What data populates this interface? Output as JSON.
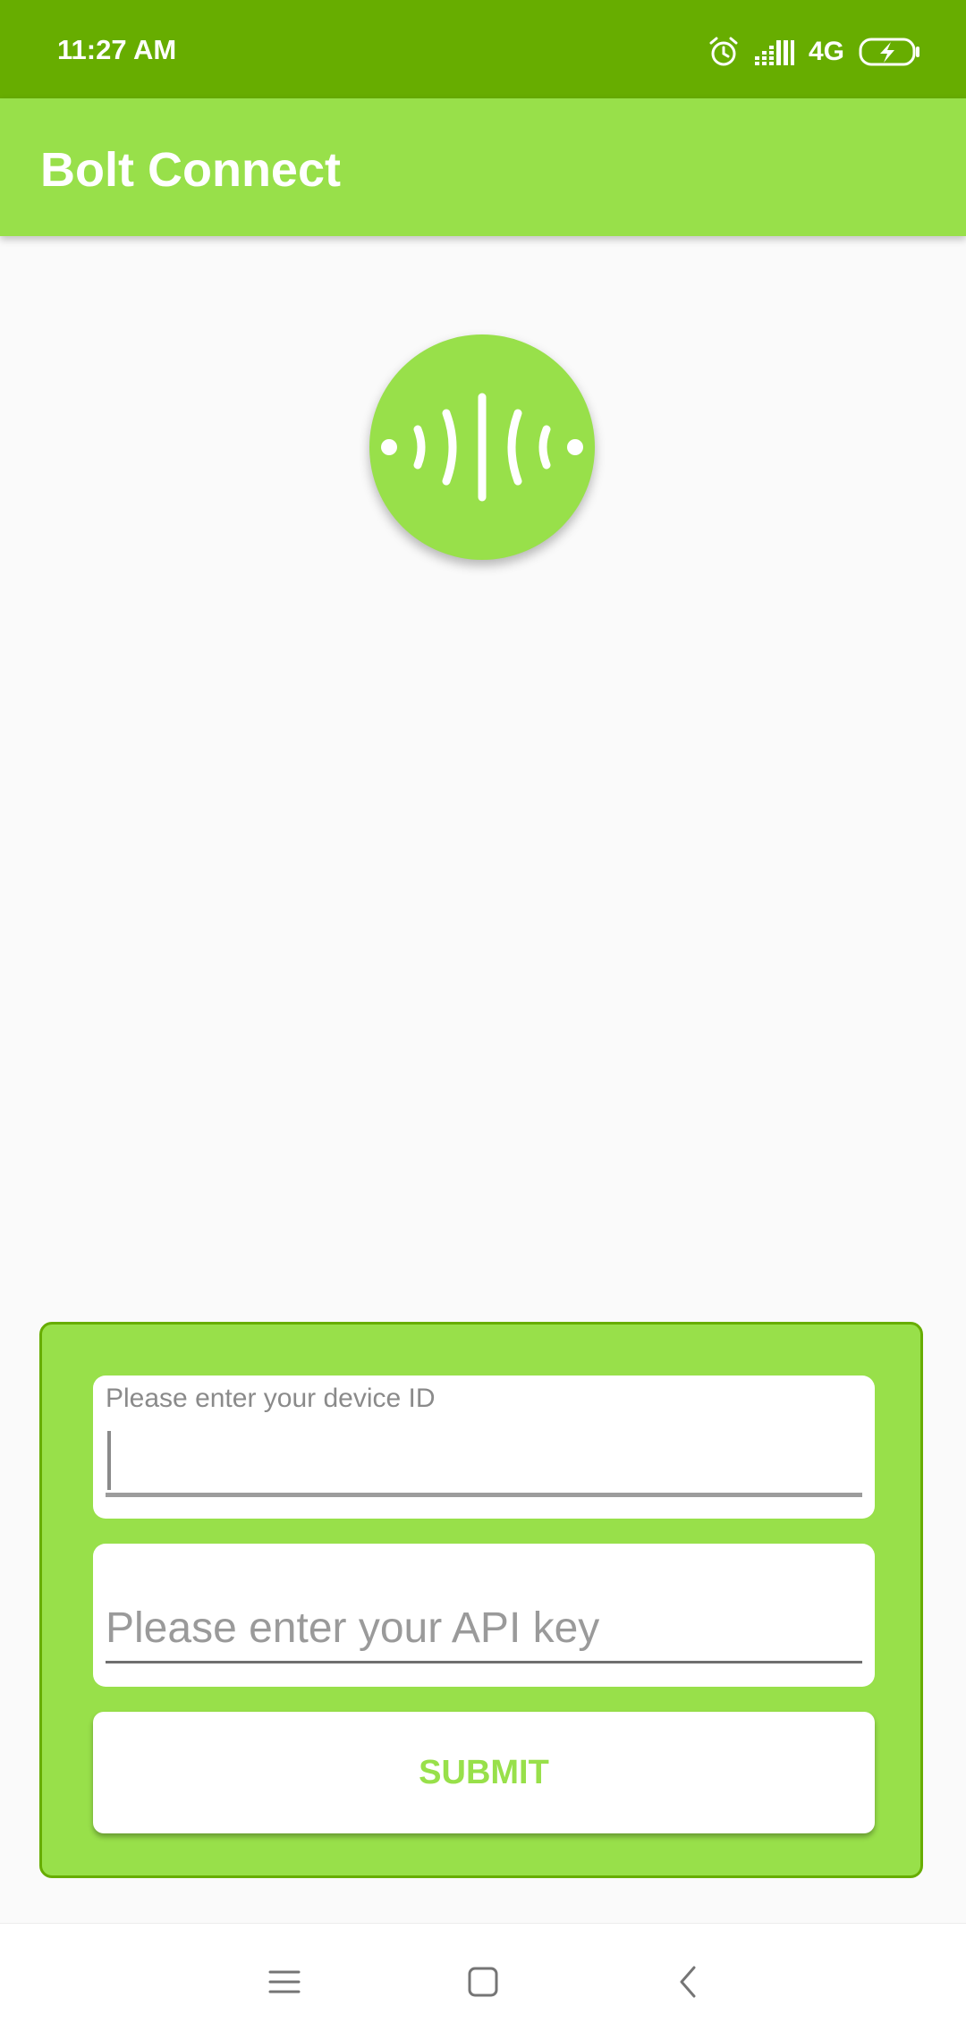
{
  "status_bar": {
    "time": "11:27 AM",
    "network": "4G",
    "icons": [
      "alarm-icon",
      "signal-icon",
      "battery-charging-icon"
    ]
  },
  "app_bar": {
    "title": "Bolt Connect"
  },
  "logo": {
    "icon": "bolt-wave-logo-icon"
  },
  "form": {
    "device_id": {
      "label": "Please enter your device ID",
      "value": ""
    },
    "api_key": {
      "placeholder": "Please enter your API key",
      "value": ""
    },
    "submit_label": "SUBMIT"
  },
  "nav_bar": {
    "buttons": [
      "menu-icon",
      "home-icon",
      "back-icon"
    ]
  },
  "colors": {
    "status_bar": "#67ad00",
    "accent": "#98e04a",
    "background": "#fafafa",
    "card_border": "#67ad00"
  }
}
